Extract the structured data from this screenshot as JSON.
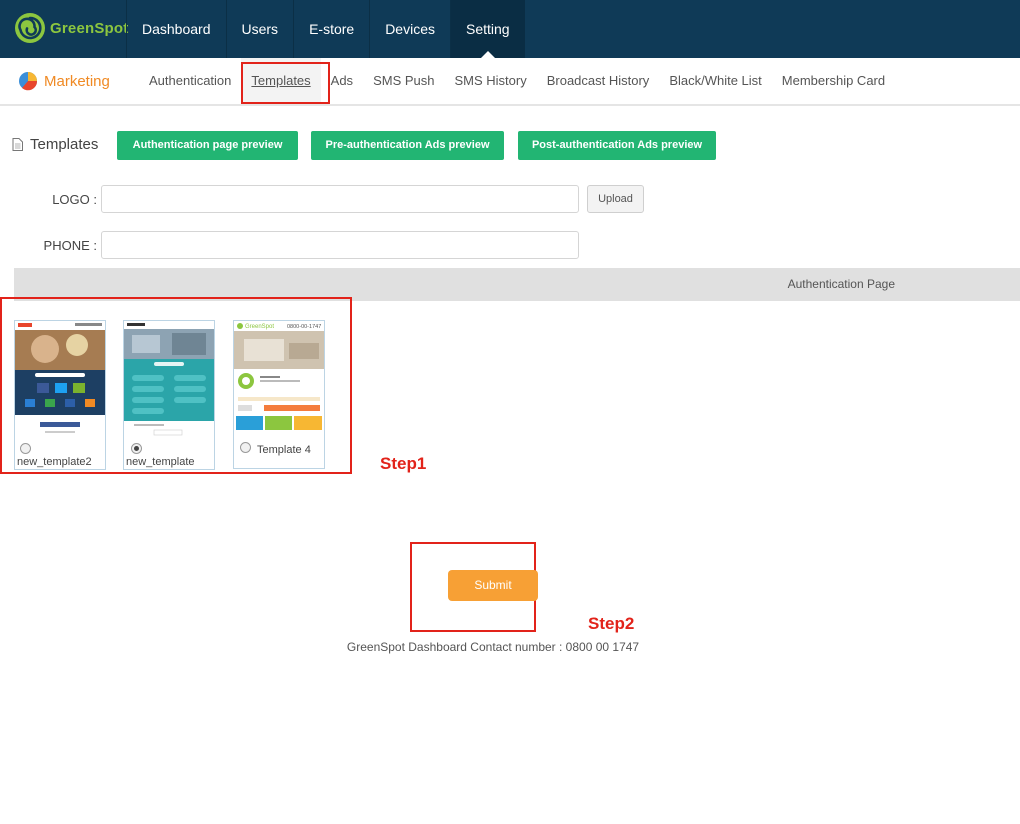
{
  "brand": {
    "name": "GreenSpot",
    "logo_color": "#8cc63f"
  },
  "nav": {
    "items": [
      {
        "label": "Dashboard"
      },
      {
        "label": "Users"
      },
      {
        "label": "E-store"
      },
      {
        "label": "Devices"
      },
      {
        "label": "Setting",
        "active": true
      }
    ]
  },
  "section": {
    "label": "Marketing",
    "icon": "pie-chart-icon"
  },
  "subnav": {
    "items": [
      {
        "label": "Authentication"
      },
      {
        "label": "Templates",
        "current": true
      },
      {
        "label": "Ads"
      },
      {
        "label": "SMS Push"
      },
      {
        "label": "SMS History"
      },
      {
        "label": "Broadcast History"
      },
      {
        "label": "Black/White List"
      },
      {
        "label": "Membership Card"
      }
    ]
  },
  "templates": {
    "title": "Templates",
    "preview_buttons": [
      "Authentication page preview",
      "Pre-authentication Ads preview",
      "Post-authentication Ads preview"
    ]
  },
  "form": {
    "logo_label": "LOGO :",
    "logo_value": "",
    "phone_label": "PHONE :",
    "phone_value": "",
    "upload_label": "Upload"
  },
  "auth_page_bar": "Authentication Page",
  "template_cards": [
    {
      "name": "new_template2",
      "selected": false
    },
    {
      "name": "new_template",
      "selected": true
    },
    {
      "name": "Template 4",
      "selected": false,
      "header_brand": "GreenSpot",
      "header_phone": "0800-00-1747"
    }
  ],
  "annotations": {
    "step1": "Step1",
    "step2": "Step2"
  },
  "submit_label": "Submit",
  "footer": "GreenSpot Dashboard Contact number : 0800 00 1747",
  "colors": {
    "topbar": "#0f3a57",
    "green_button": "#22b573",
    "submit": "#f7a035",
    "highlight": "#e2231a",
    "marketing": "#f08a24"
  }
}
